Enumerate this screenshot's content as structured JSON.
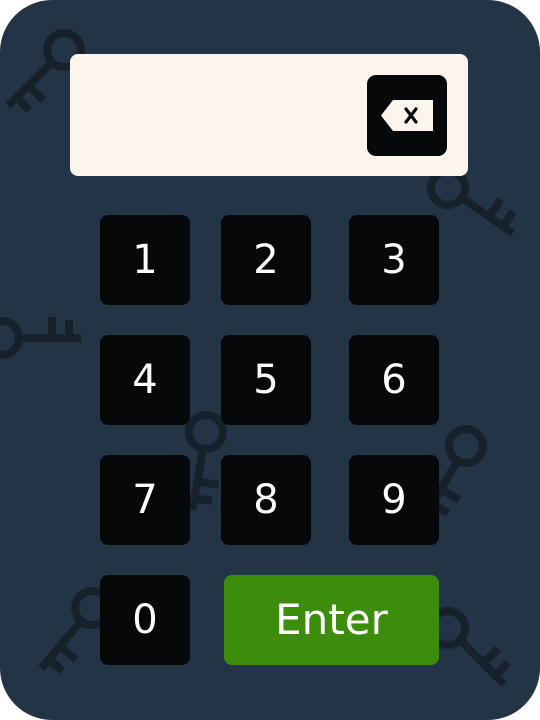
{
  "display": {
    "value": "",
    "backspace_icon": "backspace-icon"
  },
  "keypad": {
    "keys": [
      "1",
      "2",
      "3",
      "4",
      "5",
      "6",
      "7",
      "8",
      "9",
      "0"
    ],
    "enter_label": "Enter"
  },
  "colors": {
    "background": "#243447",
    "display": "#fcf5ec",
    "key": "#06080a",
    "key_text": "#ffffff",
    "enter": "#3b8d0b",
    "decor_key": "#17212c"
  },
  "decorations": {
    "icon": "key-icon"
  }
}
